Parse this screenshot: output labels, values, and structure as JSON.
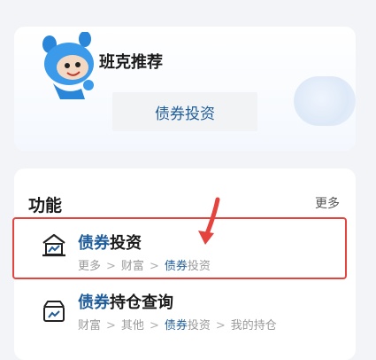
{
  "banker": {
    "title": "班克推荐",
    "chip_label": "债券投资"
  },
  "functions": {
    "title": "功能",
    "more_label": "更多",
    "items": [
      {
        "title_highlight": "债券",
        "title_rest": "投资",
        "icon": "house-chart-icon",
        "crumbs": {
          "c1": "更多",
          "c2": "财富",
          "c3_highlight": "债券",
          "c3_rest": "投资"
        }
      },
      {
        "title_highlight": "债券",
        "title_rest": "持仓查询",
        "icon": "box-chart-icon",
        "crumbs": {
          "c1": "财富",
          "c2": "其他",
          "c3_highlight": "债券",
          "c3_rest": "投资",
          "c4": "我的持仓"
        }
      }
    ],
    "separator": ">"
  },
  "colors": {
    "accent": "#1f5d9a",
    "highlight_border": "#e5443e",
    "arrow": "#e5443e"
  }
}
